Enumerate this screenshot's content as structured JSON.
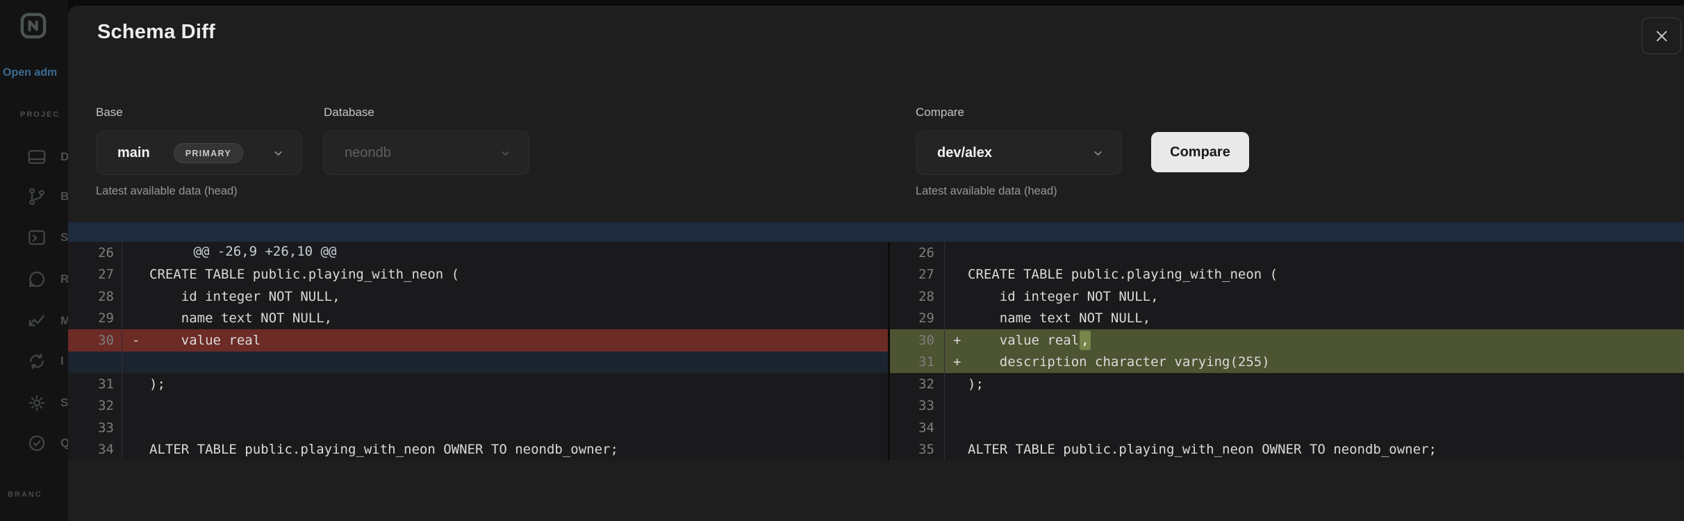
{
  "sidebar": {
    "open_link": "Open adm",
    "section_label": "PROJEC",
    "items": [
      {
        "icon": "dashboard-icon",
        "letter": "D"
      },
      {
        "icon": "branches-icon",
        "letter": "B"
      },
      {
        "icon": "sql-editor-icon",
        "letter": "S"
      },
      {
        "icon": "chat-icon",
        "letter": "R"
      },
      {
        "icon": "monitoring-icon",
        "letter": "M"
      },
      {
        "icon": "integrations-icon",
        "letter": "I"
      },
      {
        "icon": "settings-icon",
        "letter": "S"
      },
      {
        "icon": "check-circle-icon",
        "letter": "Q"
      }
    ],
    "bottom_label": "BRANC"
  },
  "modal": {
    "title": "Schema Diff",
    "form": {
      "base": {
        "label": "Base",
        "value": "main",
        "badge": "PRIMARY",
        "helper": "Latest available data (head)"
      },
      "database": {
        "label": "Database",
        "value": "neondb"
      },
      "compare": {
        "label": "Compare",
        "value": "dev/alex",
        "helper": "Latest available data (head)",
        "button": "Compare"
      }
    }
  },
  "diff": {
    "hunk_header": "@@ -26,9 +26,10 @@",
    "left": {
      "rows": [
        {
          "num": "26",
          "marker": "",
          "code": "",
          "hl": "",
          "type": "context"
        },
        {
          "num": "27",
          "marker": "",
          "code": "CREATE TABLE public.playing_with_neon (",
          "hl": "",
          "type": "context"
        },
        {
          "num": "28",
          "marker": "",
          "code": "    id integer NOT NULL,",
          "hl": "",
          "type": "context"
        },
        {
          "num": "29",
          "marker": "",
          "code": "    name text NOT NULL,",
          "hl": "",
          "type": "context"
        },
        {
          "num": "30",
          "marker": "-",
          "code": "    value real",
          "hl": "",
          "type": "removed"
        },
        {
          "num": "",
          "marker": "",
          "code": "",
          "hl": "",
          "type": "placeholder"
        },
        {
          "num": "31",
          "marker": "",
          "code": ");",
          "hl": "",
          "type": "context"
        },
        {
          "num": "32",
          "marker": "",
          "code": "",
          "hl": "",
          "type": "context"
        },
        {
          "num": "33",
          "marker": "",
          "code": "",
          "hl": "",
          "type": "context"
        },
        {
          "num": "34",
          "marker": "",
          "code": "ALTER TABLE public.playing_with_neon OWNER TO neondb_owner;",
          "hl": "",
          "type": "context"
        }
      ]
    },
    "right": {
      "rows": [
        {
          "num": "26",
          "marker": "",
          "code": "",
          "hl": "",
          "type": "context"
        },
        {
          "num": "27",
          "marker": "",
          "code": "CREATE TABLE public.playing_with_neon (",
          "hl": "",
          "type": "context"
        },
        {
          "num": "28",
          "marker": "",
          "code": "    id integer NOT NULL,",
          "hl": "",
          "type": "context"
        },
        {
          "num": "29",
          "marker": "",
          "code": "    name text NOT NULL,",
          "hl": "",
          "type": "context"
        },
        {
          "num": "30",
          "marker": "+",
          "code": "    value real",
          "hl": ",",
          "type": "added"
        },
        {
          "num": "31",
          "marker": "+",
          "code": "    description character varying(255)",
          "hl": "",
          "type": "added"
        },
        {
          "num": "32",
          "marker": "",
          "code": ");",
          "hl": "",
          "type": "context"
        },
        {
          "num": "33",
          "marker": "",
          "code": "",
          "hl": "",
          "type": "context"
        },
        {
          "num": "34",
          "marker": "",
          "code": "",
          "hl": "",
          "type": "context"
        },
        {
          "num": "35",
          "marker": "",
          "code": "ALTER TABLE public.playing_with_neon OWNER TO neondb_owner;",
          "hl": "",
          "type": "context"
        }
      ]
    }
  },
  "colors": {
    "removed_row_bg": "#6d2b26",
    "added_row_bg": "#4c5431",
    "added_word_highlight": "#78854b",
    "hunk_header_bg": "#1e2b3d",
    "placeholder_row_bg": "#1c2430",
    "primary_button_bg": "#e9e9e9",
    "link_accent": "#3c6c93"
  }
}
